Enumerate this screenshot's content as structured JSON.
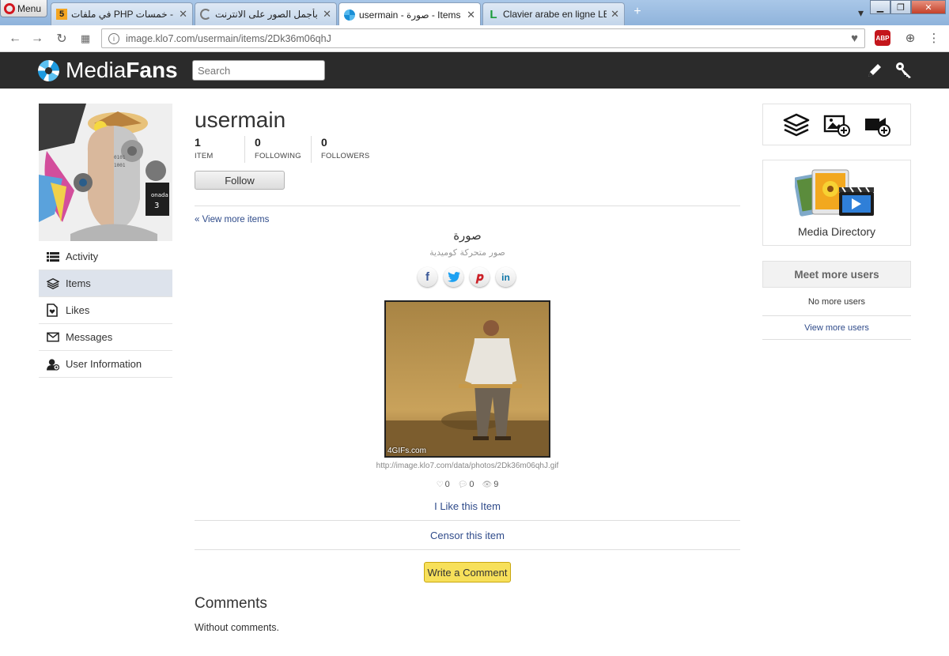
{
  "browser": {
    "menu_label": "Menu",
    "tabs": [
      {
        "title": "في ملفات PHP لموقعك - خمسات",
        "icon": "fav-5",
        "icon_text": "5"
      },
      {
        "title": "استمتع بأجمل الصور على الانترنت",
        "icon": "fav-spin",
        "icon_text": ""
      },
      {
        "title": "usermain - صورة - Items - ...",
        "icon": "fav-aperture",
        "icon_text": ""
      },
      {
        "title": "Clavier arabe en ligne LEXI",
        "icon": "fav-L",
        "icon_text": "L"
      }
    ],
    "url": "image.klo7.com/usermain/items/2Dk36m06qhJ",
    "abp_label": "ABP"
  },
  "header": {
    "logo_light": "Media",
    "logo_bold": "Fans",
    "search_placeholder": "Search"
  },
  "sidebar": {
    "items": [
      {
        "label": "Activity",
        "icon": "activity-list-icon"
      },
      {
        "label": "Items",
        "icon": "layers-icon"
      },
      {
        "label": "Likes",
        "icon": "likes-file-icon"
      },
      {
        "label": "Messages",
        "icon": "envelope-icon"
      },
      {
        "label": "User Information",
        "icon": "user-info-icon"
      }
    ]
  },
  "profile": {
    "username": "usermain",
    "stats": [
      {
        "value": "1",
        "label": "ITEM"
      },
      {
        "value": "0",
        "label": "FOLLOWING"
      },
      {
        "value": "0",
        "label": "FOLLOWERS"
      }
    ],
    "follow_label": "Follow"
  },
  "item": {
    "view_more": "« View more items",
    "title": "صورة",
    "description": "صور متحركة كوميدية",
    "watermark": "4GIFs.com",
    "image_url": "http://image.klo7.com/data/photos/2Dk36m06qhJ.gif",
    "likes": "0",
    "comments": "0",
    "views": "9",
    "like_label": "I Like this Item",
    "censor_label": "Censor this item",
    "comment_button": "Write a Comment"
  },
  "comments": {
    "heading": "Comments",
    "empty": "Without comments."
  },
  "right": {
    "media_directory": "Media Directory",
    "meet_users": "Meet more users",
    "no_users": "No more users",
    "view_users": "View more users"
  }
}
